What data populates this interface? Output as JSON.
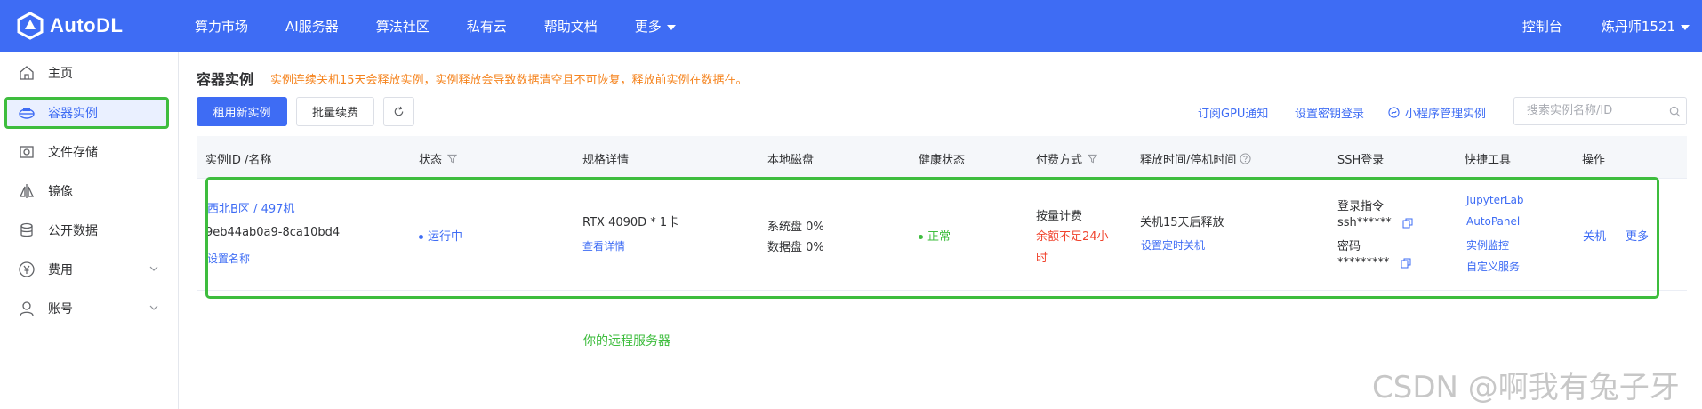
{
  "brand": {
    "name": "AutoDL"
  },
  "topnav": {
    "items": [
      "算力市场",
      "AI服务器",
      "算法社区",
      "私有云",
      "帮助文档",
      "更多"
    ],
    "console": "控制台",
    "user": "炼丹师1521"
  },
  "sidebar": {
    "items": [
      {
        "label": "主页",
        "icon": "home-icon"
      },
      {
        "label": "容器实例",
        "icon": "container-icon",
        "active": true
      },
      {
        "label": "文件存储",
        "icon": "storage-icon"
      },
      {
        "label": "镜像",
        "icon": "image-icon"
      },
      {
        "label": "公开数据",
        "icon": "database-icon"
      },
      {
        "label": "费用",
        "icon": "yen-icon",
        "expandable": true
      },
      {
        "label": "账号",
        "icon": "user-icon",
        "expandable": true
      }
    ]
  },
  "page": {
    "title": "容器实例",
    "warning": "实例连续关机15天会释放实例，实例释放会导致数据清空且不可恢复，释放前实例在数据在。"
  },
  "toolbar": {
    "rent_new": "租用新实例",
    "batch_renew": "批量续费",
    "subscribe_gpu": "订阅GPU通知",
    "set_key_login": "设置密钥登录",
    "miniapp_manage": "小程序管理实例",
    "search_placeholder": "搜索实例名称/ID"
  },
  "table": {
    "headers": [
      "实例ID /名称",
      "状态",
      "规格详情",
      "本地磁盘",
      "健康状态",
      "付费方式",
      "释放时间/停机时间",
      "SSH登录",
      "快捷工具",
      "操作"
    ],
    "rows": [
      {
        "region": "西北B区 / 497机",
        "id": "9eb44ab0a9-8ca10bd4",
        "set_name": "设置名称",
        "status": "运行中",
        "spec": "RTX 4090D * 1卡",
        "spec_detail": "查看详情",
        "sys_disk": "系统盘 0%",
        "data_disk": "数据盘 0%",
        "health": "正常",
        "billing": "按量计费",
        "balance_warning_1": "余额不足24小",
        "balance_warning_2": "时",
        "release": "关机15天后释放",
        "set_timer": "设置定时关机",
        "ssh_cmd_label": "登录指令",
        "ssh_cmd": "ssh******",
        "pwd_label": "密码",
        "pwd": "*********",
        "tools": [
          "JupyterLab",
          "AutoPanel",
          "实例监控",
          "自定义服务"
        ],
        "actions": [
          "关机",
          "更多"
        ]
      }
    ]
  },
  "annotation": "你的远程服务器",
  "watermark": "CSDN @啊我有兔子牙",
  "colors": {
    "brand": "#3e6cf4",
    "warning": "#f5841f",
    "highlight": "#3ebd3e",
    "danger": "#f0442e"
  }
}
